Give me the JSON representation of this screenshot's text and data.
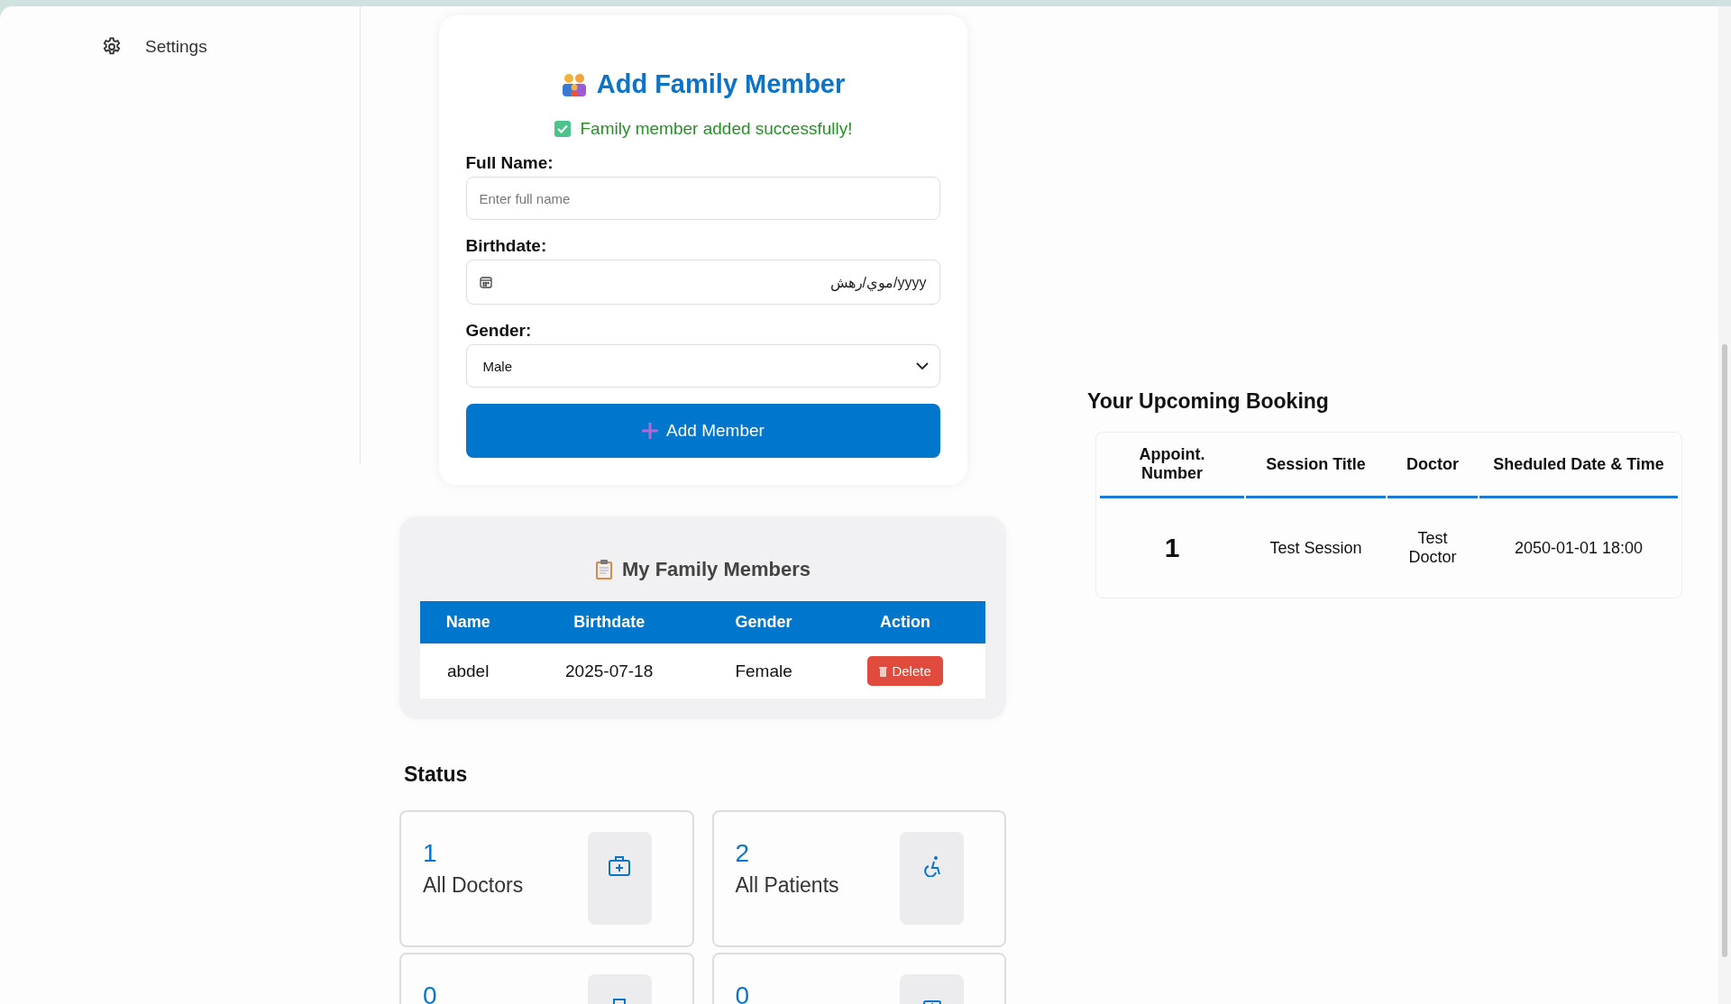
{
  "sidebar": {
    "items": [
      {
        "label": "Settings"
      }
    ]
  },
  "add_member_form": {
    "title": "Add Family Member",
    "success_message": "Family member added successfully!",
    "fields": [
      {
        "kind": "text",
        "label": "Full Name:",
        "placeholder": "Enter full name"
      },
      {
        "kind": "date",
        "label": "Birthdate:",
        "placeholder": "موي/رهش/yyyy"
      },
      {
        "kind": "select",
        "label": "Gender:",
        "value": "Male"
      }
    ],
    "submit_button": "Add Member"
  },
  "family_members": {
    "title": "My Family Members",
    "columns": [
      "Name",
      "Birthdate",
      "Gender",
      "Action"
    ],
    "rows": [
      {
        "cells": [
          "abdel",
          "2025-07-18",
          "Female"
        ],
        "action": "Delete"
      }
    ]
  },
  "status": {
    "title": "Status",
    "cards": [
      {
        "kind": "doctors",
        "value": "1",
        "label": "All Doctors"
      },
      {
        "kind": "patients",
        "value": "2",
        "label": "All Patients"
      },
      {
        "kind": "bookings",
        "value": "0"
      },
      {
        "kind": "sessions",
        "value": "0"
      }
    ]
  },
  "upcoming_booking": {
    "title": "Your Upcoming Booking",
    "columns": [
      "Appoint. Number",
      "Session Title",
      "Doctor",
      "Sheduled Date & Time"
    ],
    "rows": [
      {
        "cells": [
          "1",
          "Test Session",
          "Test Doctor",
          "2050-01-01 18:00"
        ]
      }
    ]
  }
}
